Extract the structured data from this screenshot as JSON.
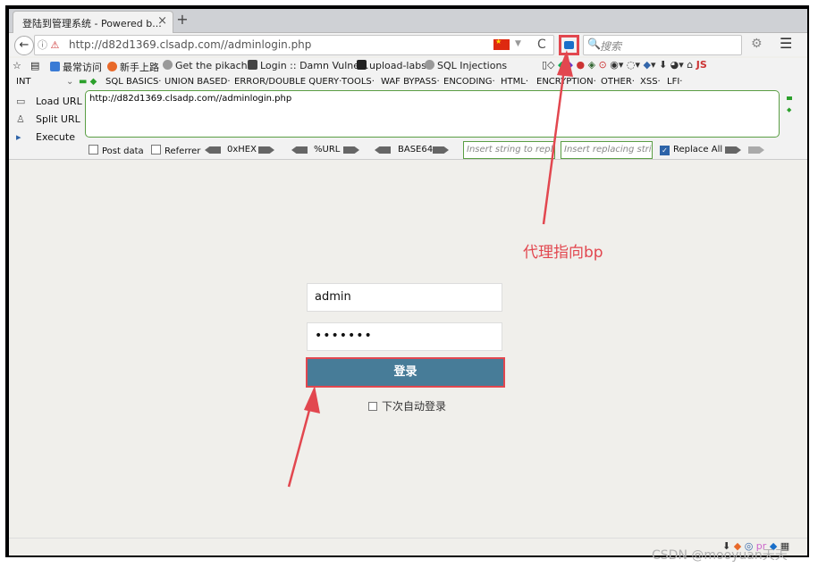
{
  "tab": {
    "title": "登陆到管理系统 - Powered b...",
    "close": "×",
    "new": "+"
  },
  "nav": {
    "back": "←",
    "url": "http://d82d1369.clsadp.com//adminlogin.php",
    "search_placeholder": "搜索",
    "reload": "C"
  },
  "bookmarks": [
    {
      "label": "最常访问",
      "color": "#3a7bd5"
    },
    {
      "label": "新手上路",
      "color": "#e8692a"
    },
    {
      "label": "Get the pikachu",
      "color": "#888888"
    },
    {
      "label": "Login :: Damn Vulne...",
      "color": "#444444"
    },
    {
      "label": "upload-labs",
      "color": "#222222"
    },
    {
      "label": "SQL Injections",
      "color": "#888888"
    }
  ],
  "hackbar": {
    "int_label": "INT",
    "menu": [
      "SQL BASICS·",
      "UNION BASED·",
      "ERROR/DOUBLE QUERY·",
      "TOOLS·",
      "WAF BYPASS·",
      "ENCODING·",
      "HTML·",
      "ENCRYPTION·",
      "OTHER·",
      "XSS·",
      "LFI·"
    ],
    "load_url": "Load URL",
    "split_url": "Split URL",
    "execute": "Execute",
    "url_value": "http://d82d1369.clsadp.com//adminlogin.php",
    "post_data": "Post data",
    "referrer": "Referrer",
    "hex": "0xHEX",
    "url_enc": "%URL",
    "base64": "BASE64",
    "insert_string": "Insert string to replace",
    "insert_replacing": "Insert replacing string",
    "replace_all": "Replace All"
  },
  "login": {
    "username": "admin",
    "password": "•••••••",
    "button": "登录",
    "remember": "下次自动登录"
  },
  "annotation": {
    "text": "代理指向bp",
    "color": "#e2474f"
  },
  "watermark": "CSDN @mooyuan天天"
}
